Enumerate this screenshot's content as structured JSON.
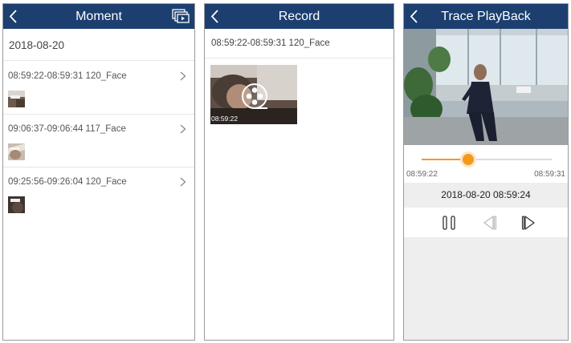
{
  "moment": {
    "title": "Moment",
    "date": "2018-08-20",
    "records": [
      {
        "range": "08:59:22-08:59:31 120_Face"
      },
      {
        "range": "09:06:37-09:06:44 117_Face"
      },
      {
        "range": "09:25:56-09:26:04 120_Face"
      }
    ]
  },
  "record": {
    "title": "Record",
    "range": "08:59:22-08:59:31 120_Face",
    "thumb_time": "08:59:22"
  },
  "playback": {
    "title": "Trace PlayBack",
    "start": "08:59:22",
    "end": "08:59:31",
    "current": "2018-08-20 08:59:24",
    "progress": 0.36
  },
  "colors": {
    "nav": "#1c3f70",
    "accent": "#f39a1e"
  }
}
